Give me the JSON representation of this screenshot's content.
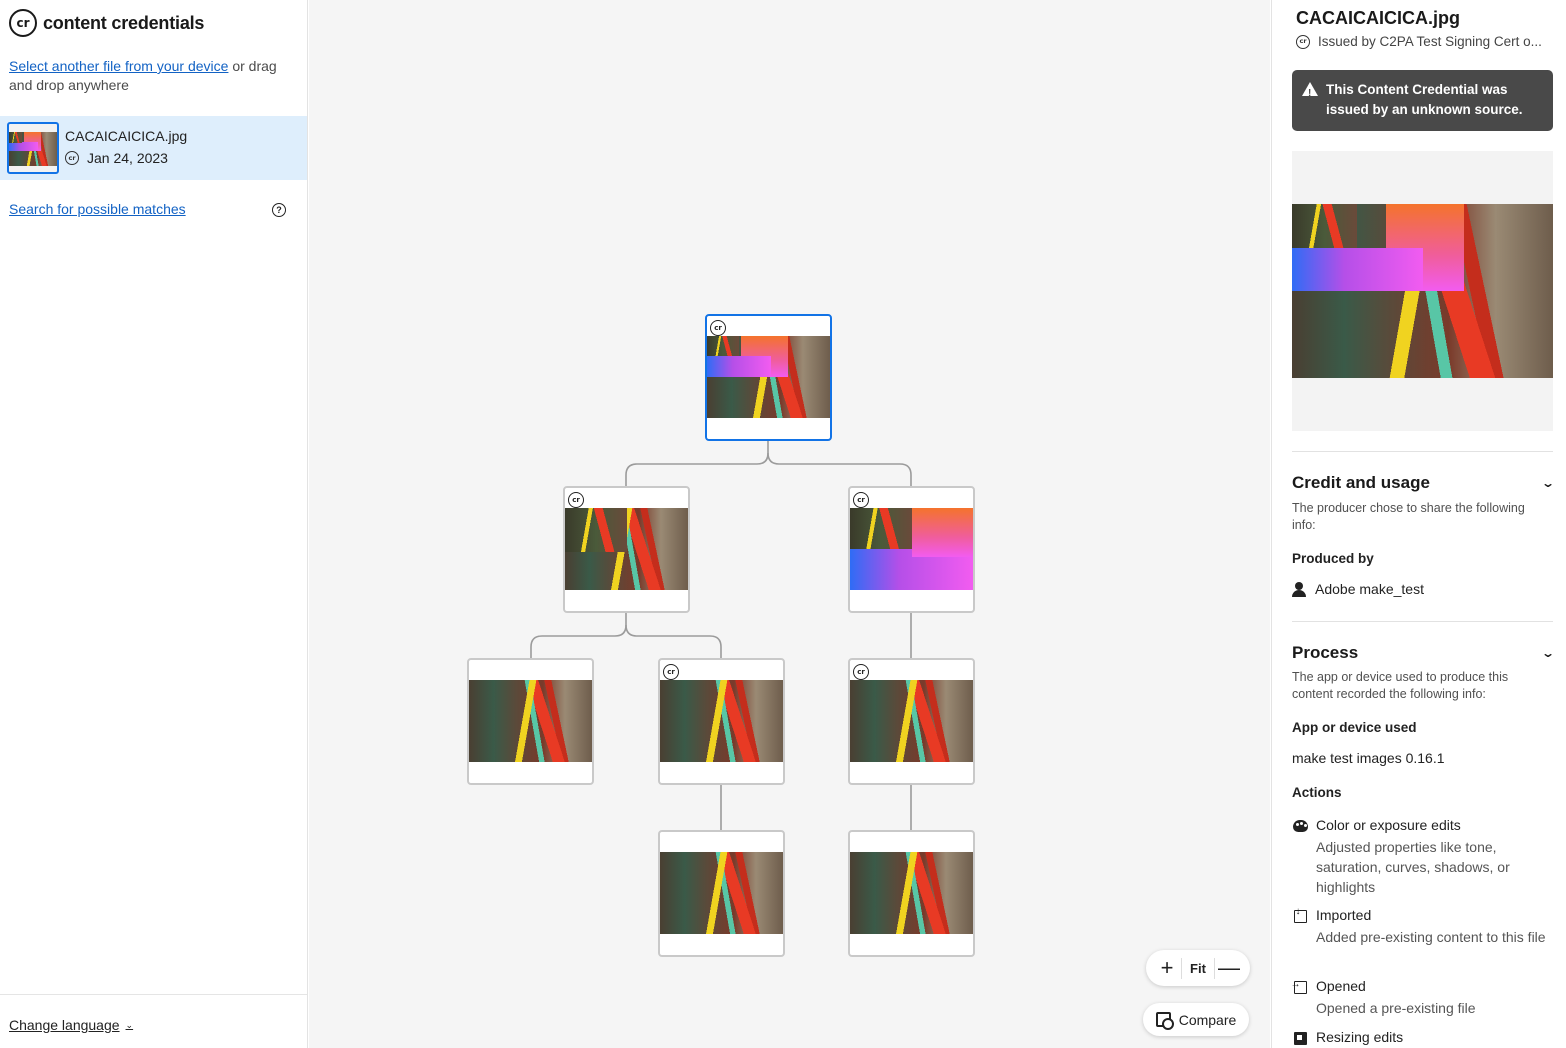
{
  "brand": {
    "name": "content credentials",
    "logo_text": "cr"
  },
  "sidebar": {
    "upload_link": "Select another file from your device",
    "upload_rest": " or drag and drop anywhere",
    "file": {
      "name": "CACAICAICICA.jpg",
      "date": "Jan 24, 2023"
    },
    "search_link": "Search for possible matches",
    "help_glyph": "?",
    "change_language": "Change language",
    "chevron": "⌄"
  },
  "canvas": {
    "zoom_in": "+",
    "fit": "Fit",
    "zoom_out": "—",
    "compare": "Compare"
  },
  "panel": {
    "title": "CACAICAICICA.jpg",
    "issuer": "Issued by C2PA Test Signing Cert o...",
    "warning": "This Content Credential was issued by an unknown source.",
    "credit": {
      "heading": "Credit and usage",
      "desc": "The producer chose to share the following info:",
      "produced_by_label": "Produced by",
      "producer": "Adobe make_test"
    },
    "process": {
      "heading": "Process",
      "desc": "The app or device used to produce this content recorded the following info:",
      "app_label": "App or device used",
      "app": "make test images 0.16.1",
      "actions_label": "Actions",
      "actions": [
        {
          "icon": "palette-icon",
          "title": "Color or exposure edits",
          "desc": "Adjusted properties like tone, saturation, curves, shadows, or highlights"
        },
        {
          "icon": "import-icon",
          "title": "Imported",
          "desc": "Added pre-existing content to this file"
        },
        {
          "icon": "open-icon",
          "title": "Opened",
          "desc": "Opened a pre-existing file"
        },
        {
          "icon": "resize-icon",
          "title": "Resizing edits",
          "desc": ""
        }
      ]
    }
  },
  "colors": {
    "accent": "#1273e6",
    "link": "#1262c4",
    "selected_bg": "#deeefc",
    "warning_bg": "#494949"
  }
}
